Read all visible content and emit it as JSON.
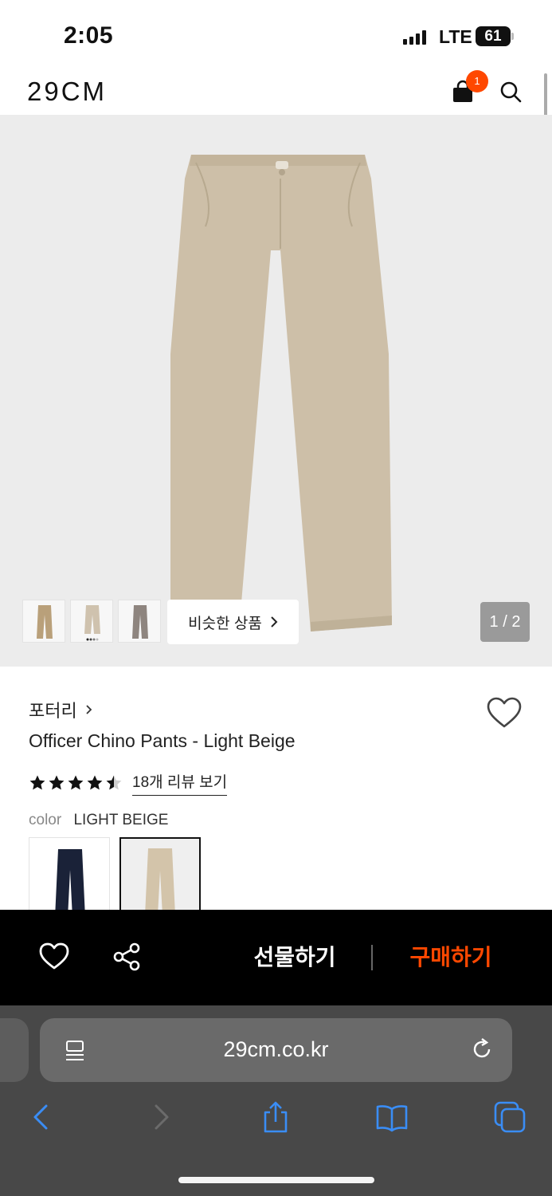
{
  "status_bar": {
    "time": "2:05",
    "network": "LTE",
    "battery": "61"
  },
  "header": {
    "logo": "29CM",
    "cart_count": "1"
  },
  "gallery": {
    "similar_label": "비슷한 상품",
    "page_indicator": "1 / 2",
    "thumb_colors": [
      "#b9a07a",
      "#cfc2ae",
      "#8e857f"
    ]
  },
  "product": {
    "brand": "포터리",
    "name": "Officer Chino Pants - Light Beige",
    "rating": 4.5,
    "review_link": "18개 리뷰 보기",
    "color_label": "color",
    "color_value": "LIGHT BEIGE",
    "swatches": [
      {
        "color": "#1a2238",
        "selected": false
      },
      {
        "color": "#d3c4aa",
        "selected": true
      }
    ]
  },
  "bottom_bar": {
    "gift_label": "선물하기",
    "buy_label": "구매하기",
    "accent": "#ff4800"
  },
  "browser": {
    "url": "29cm.co.kr"
  }
}
